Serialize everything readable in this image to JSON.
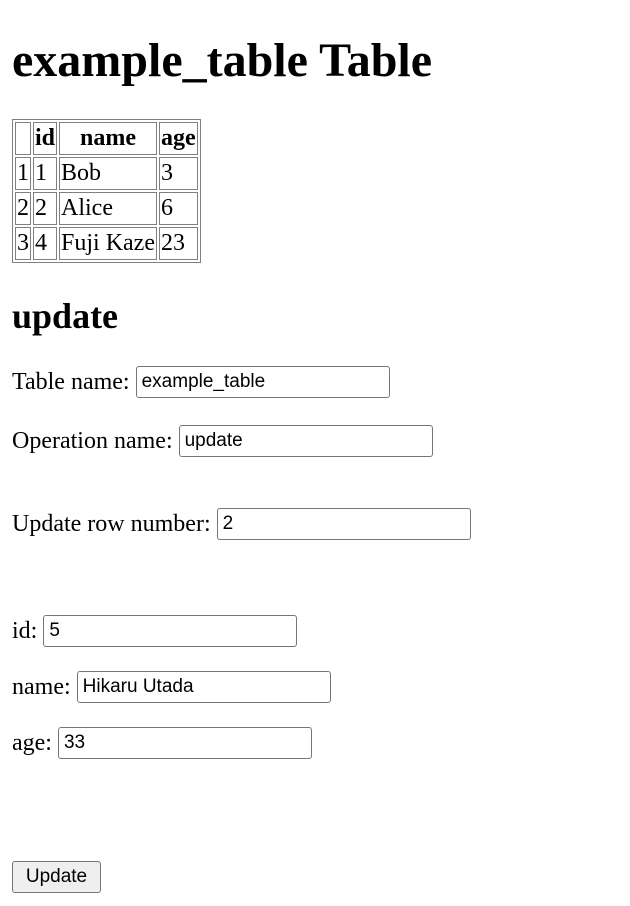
{
  "page": {
    "title": "example_table Table"
  },
  "table": {
    "headers": [
      "",
      "id",
      "name",
      "age"
    ],
    "rows": [
      [
        "1",
        "1",
        "Bob",
        "3"
      ],
      [
        "2",
        "2",
        "Alice",
        "6"
      ],
      [
        "3",
        "4",
        "Fuji Kaze",
        "23"
      ]
    ]
  },
  "form": {
    "section_title": "update",
    "table_name": {
      "label": "Table name:",
      "value": "example_table"
    },
    "operation_name": {
      "label": "Operation name:",
      "value": "update"
    },
    "row_number": {
      "label": "Update row number:",
      "value": "2"
    },
    "fields": [
      {
        "label": "id:",
        "value": "5"
      },
      {
        "label": "name:",
        "value": "Hikaru Utada"
      },
      {
        "label": "age:",
        "value": "33"
      }
    ],
    "submit_label": "Update"
  }
}
